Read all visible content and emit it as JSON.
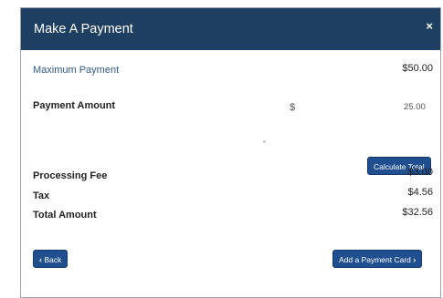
{
  "modal": {
    "title": "Make A Payment",
    "close_label": "×"
  },
  "rows": {
    "max_payment_label": "Maximum Payment",
    "max_payment_value": "$50.00",
    "payment_amount_label": "Payment Amount",
    "currency_symbol": "$",
    "payment_amount_value": "25.00",
    "processing_fee_label": "Processing Fee",
    "processing_fee_value": "$3.00",
    "tax_label": "Tax",
    "tax_value": "$4.56",
    "total_label": "Total Amount",
    "total_value": "$32.56"
  },
  "buttons": {
    "calculate_label": "Calculate Total",
    "back_label": "Back",
    "back_icon": "‹",
    "add_card_label": "Add a Payment Card",
    "add_card_icon": "›"
  },
  "colors": {
    "header_bg": "#1f3f62",
    "button_bg": "#1f4f8f",
    "link_text": "#2f5a8a"
  }
}
